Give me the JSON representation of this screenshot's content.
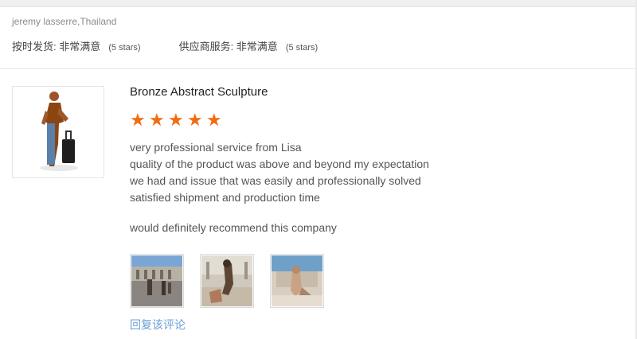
{
  "reviewer": "jeremy lasserre,Thailand",
  "ratings": [
    {
      "label": "按时发货: 非常满意",
      "stars": "(5 stars)"
    },
    {
      "label": "供应商服务: 非常满意",
      "stars": "(5 stars)"
    }
  ],
  "product": {
    "title": "Bronze Abstract Sculpture",
    "rating": 5,
    "comment_lines": [
      "very professional service from Lisa",
      "quality of the product was above and beyond my expectation",
      "we had and issue that was easily and professionally solved",
      "satisfied shipment and production time"
    ],
    "recommend": "would definitely recommend this company"
  },
  "photos_count": 3,
  "reply_label": "回复该评论",
  "colors": {
    "star": "#f36b0f",
    "link": "#6a9fd8"
  }
}
